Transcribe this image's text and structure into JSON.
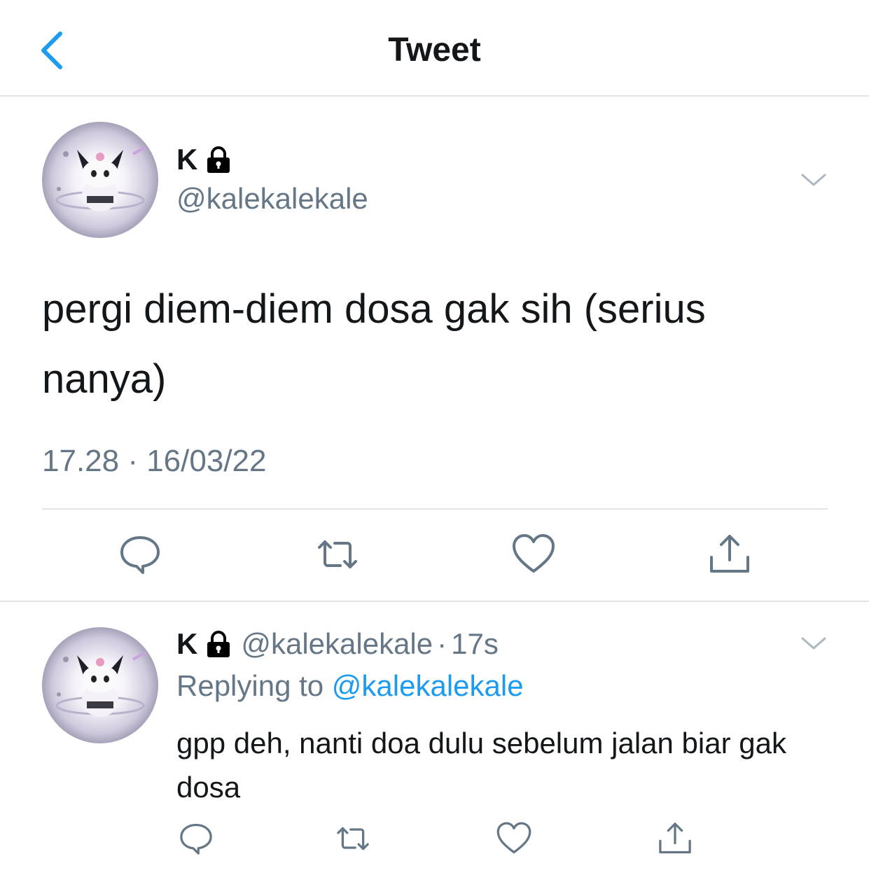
{
  "nav": {
    "title": "Tweet"
  },
  "tweet": {
    "display_name": "K",
    "handle": "@kalekalekale",
    "text": "pergi diem-diem dosa gak sih (serius nanya)",
    "timestamp": "17.28 · 16/03/22"
  },
  "reply": {
    "display_name": "K",
    "handle": "@kalekalekale",
    "dot": "·",
    "time": "17s",
    "replying_prefix": "Replying to ",
    "replying_mention": "@kalekalekale",
    "text": "gpp deh, nanti doa dulu sebelum jalan biar gak dosa"
  },
  "icons": {
    "back": "chevron-left-icon",
    "lock": "lock-icon",
    "menu": "chevron-down-icon",
    "reply": "reply-bubble-icon",
    "retweet": "retweet-icon",
    "like": "heart-icon",
    "share": "share-icon"
  },
  "colors": {
    "accent": "#1d9bf0",
    "secondary_text": "#657786",
    "divider": "#e1e4e6"
  }
}
